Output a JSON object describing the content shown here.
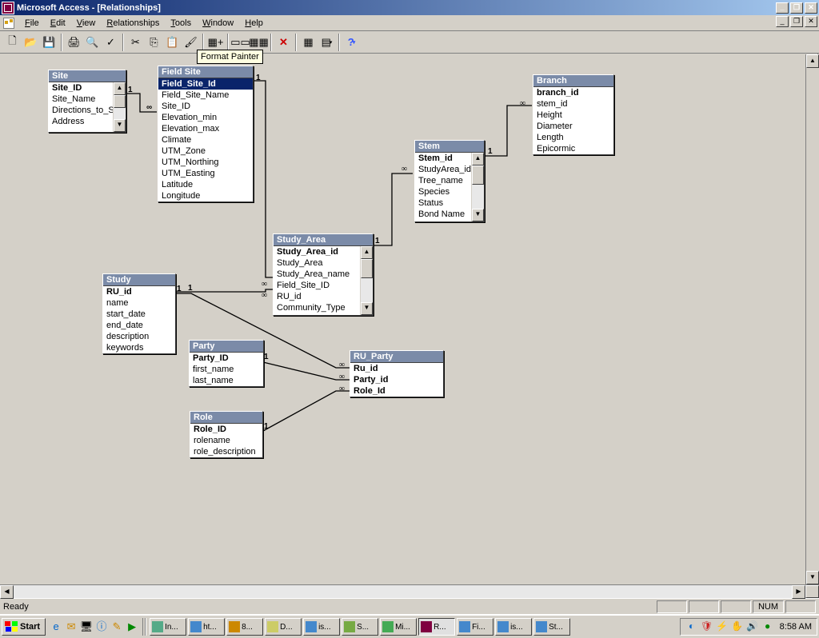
{
  "window": {
    "title": "Microsoft Access - [Relationships]",
    "tooltip": "Format Painter"
  },
  "menu": {
    "file": "File",
    "edit": "Edit",
    "view": "View",
    "relationships": "Relationships",
    "tools": "Tools",
    "window": "Window",
    "help": "Help"
  },
  "status": {
    "ready": "Ready",
    "num": "NUM"
  },
  "taskbar": {
    "start": "Start",
    "items": [
      "In...",
      "ht...",
      "8...",
      "D...",
      "is...",
      "S...",
      "Mi...",
      "R...",
      "Fi...",
      "is...",
      "St..."
    ],
    "clock": "8:58 AM"
  },
  "tables": {
    "site": {
      "title": "Site",
      "fields": [
        "Site_ID",
        "Site_Name",
        "Directions_to_Si",
        "Address"
      ]
    },
    "fieldsite": {
      "title": "Field Site",
      "fields": [
        "Field_Site_Id",
        "Field_Site_Name",
        "Site_ID",
        "Elevation_min",
        "Elevation_max",
        "Climate",
        "UTM_Zone",
        "UTM_Northing",
        "UTM_Easting",
        "Latitude",
        "Longitude"
      ]
    },
    "branch": {
      "title": "Branch",
      "fields": [
        "branch_id",
        "stem_id",
        "Height",
        "Diameter",
        "Length",
        "Epicormic"
      ]
    },
    "stem": {
      "title": "Stem",
      "fields": [
        "Stem_id",
        "StudyArea_id",
        "Tree_name",
        "Species",
        "Status",
        "Bond Name"
      ]
    },
    "studyarea": {
      "title": "Study_Area",
      "fields": [
        "Study_Area_id",
        "Study_Area",
        "Study_Area_name",
        "Field_Site_ID",
        "RU_id",
        "Community_Type"
      ]
    },
    "study": {
      "title": "Study",
      "fields": [
        "RU_id",
        "name",
        "start_date",
        "end_date",
        "description",
        "keywords"
      ]
    },
    "party": {
      "title": "Party",
      "fields": [
        "Party_ID",
        "first_name",
        "last_name"
      ]
    },
    "role": {
      "title": "Role",
      "fields": [
        "Role_ID",
        "rolename",
        "role_description"
      ]
    },
    "ruparty": {
      "title": "RU_Party",
      "fields": [
        "Ru_id",
        "Party_id",
        "Role_Id"
      ]
    }
  },
  "labels": {
    "one": "1",
    "inf": "∞"
  }
}
